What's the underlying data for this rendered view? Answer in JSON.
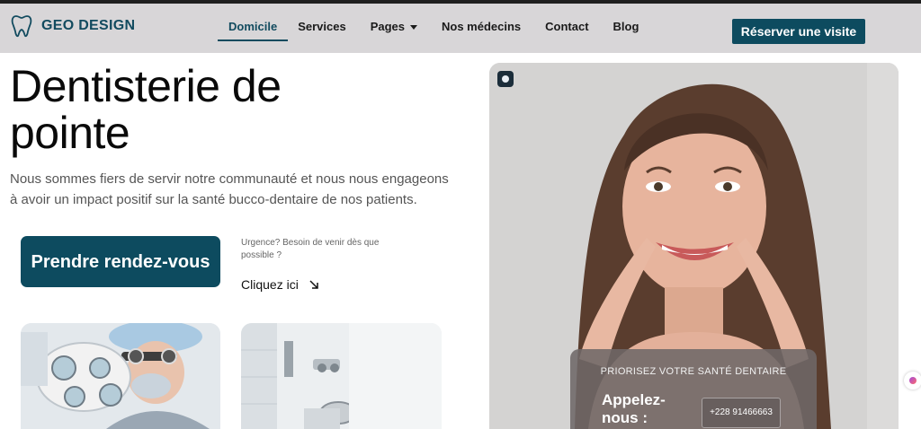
{
  "header": {
    "logo_text": "GEO DESIGN",
    "nav": [
      {
        "label": "Domicile",
        "active": true
      },
      {
        "label": "Services"
      },
      {
        "label": "Pages",
        "has_dropdown": true
      },
      {
        "label": "Nos médecins"
      },
      {
        "label": "Contact"
      },
      {
        "label": "Blog"
      }
    ],
    "cta_label": "Réserver une visite"
  },
  "hero": {
    "title": "Dentisterie de pointe",
    "subtitle": "Nous sommes fiers de servir notre communauté et nous nous engageons à avoir un impact positif sur la santé bucco-dentaire de nos patients.",
    "primary_button": "Prendre rendez-vous",
    "urgency_text": "Urgence? Besoin de venir dès que possible ?",
    "urgency_link": "Cliquez ici"
  },
  "cta_box": {
    "title": "PRIORISEZ VOTRE SANTÉ DENTAIRE",
    "call_label": "Appelez-nous :",
    "phone": "+228 91466663"
  },
  "icons": {
    "logo": "tooth-icon",
    "dropdown": "chevron-down-icon",
    "link_arrow": "arrow-down-right-icon"
  },
  "colors": {
    "brand": "#0d4b5f",
    "header_bg": "#d8d6d8"
  }
}
